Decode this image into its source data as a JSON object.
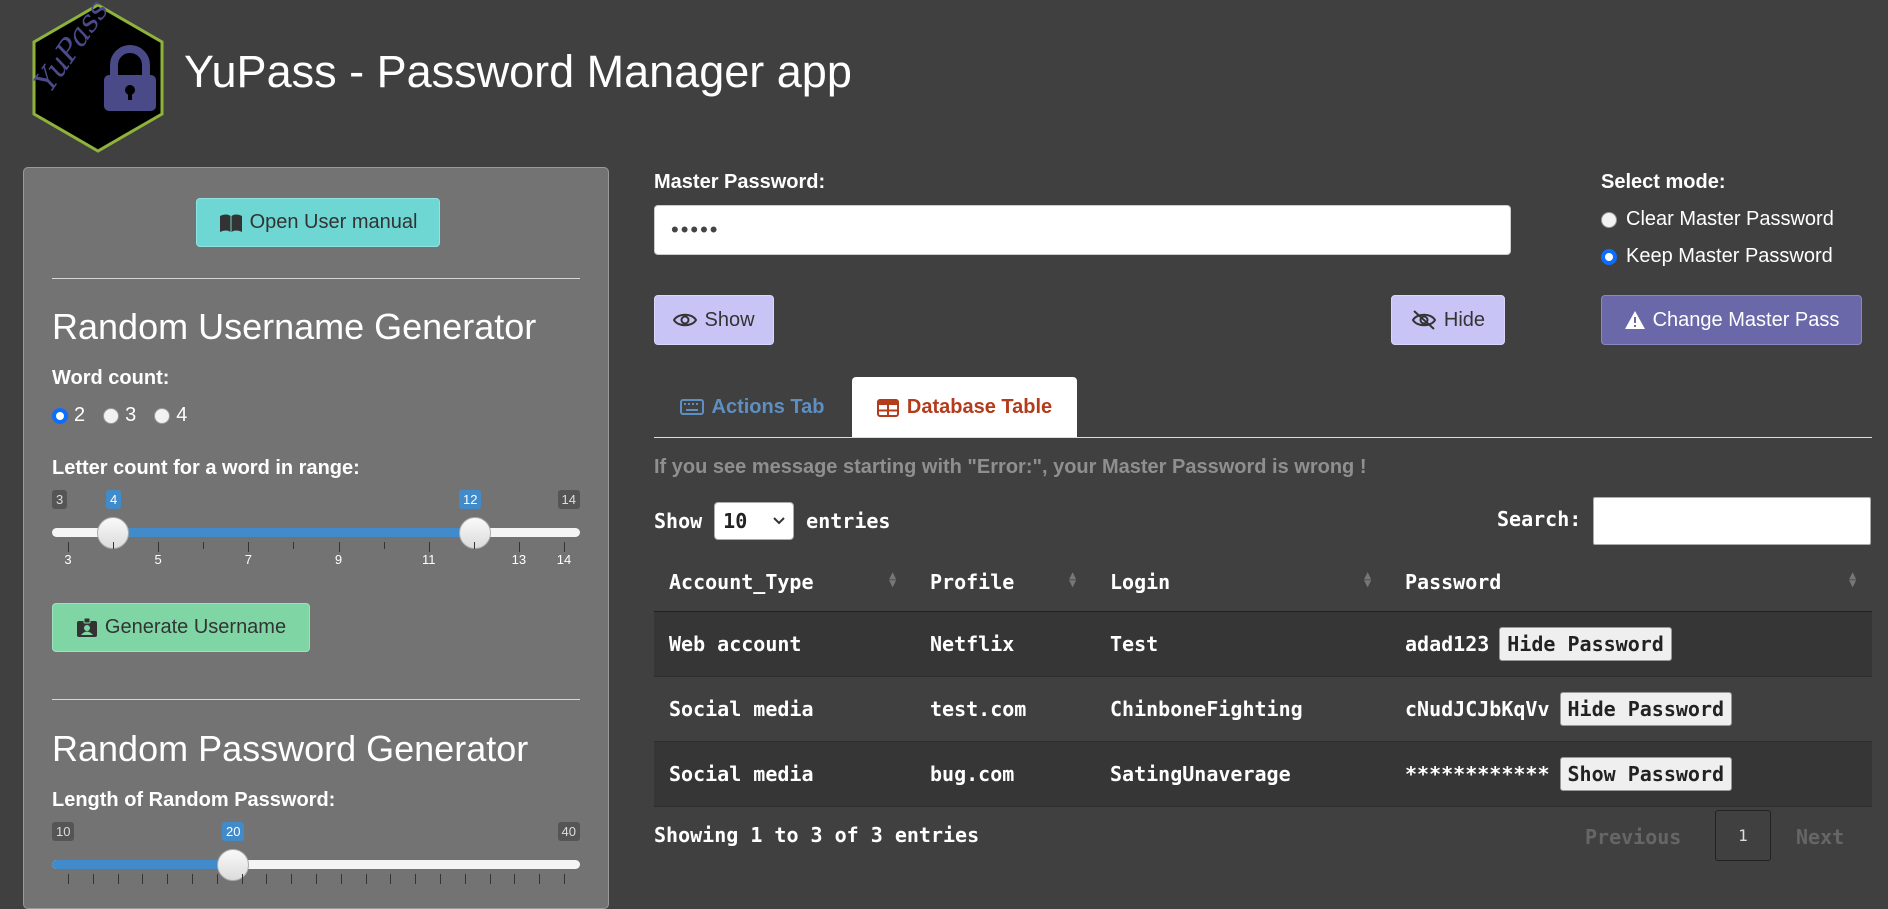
{
  "header": {
    "title": "YuPass - Password Manager app",
    "logo_text": "YuPass"
  },
  "sidebar": {
    "manual_button": "Open User manual",
    "username_section_title": "Random Username Generator",
    "word_count_label": "Word count:",
    "word_count_options": [
      "2",
      "3",
      "4"
    ],
    "word_count_selected": "2",
    "letter_range_label": "Letter count for a word in range:",
    "letter_slider": {
      "min": 3,
      "max": 14,
      "from": 4,
      "to": 12,
      "min_label": "3",
      "max_label": "14",
      "from_label": "4",
      "to_label": "12",
      "ticks": [
        "3",
        "5",
        "7",
        "9",
        "11",
        "13",
        "14"
      ]
    },
    "generate_username_button": "Generate Username",
    "password_section_title": "Random Password Generator",
    "password_length_label": "Length of Random Password:",
    "password_slider": {
      "min": 10,
      "max": 40,
      "value": 20,
      "min_label": "10",
      "max_label": "40",
      "value_label": "20"
    }
  },
  "main": {
    "master_label": "Master Password:",
    "master_value": "•••••",
    "show_button": "Show",
    "hide_button": "Hide",
    "mode_label": "Select mode:",
    "mode_options": [
      "Clear Master Password",
      "Keep Master Password"
    ],
    "mode_selected": "Keep Master Password",
    "change_button": "Change Master Pass",
    "tabs": [
      {
        "label": "Actions Tab",
        "active": false
      },
      {
        "label": "Database Table",
        "active": true
      }
    ],
    "warning": "If you see message starting with \"Error:\", your Master Password is wrong !",
    "length_show": "Show",
    "length_value": "10",
    "length_entries": "entries",
    "search_label": "Search:",
    "search_value": ""
  },
  "table": {
    "columns": [
      "Account_Type",
      "Profile",
      "Login",
      "Password"
    ],
    "rows": [
      {
        "account_type": "Web account",
        "profile": "Netflix",
        "login": "Test",
        "password": "adad123",
        "button": "Hide Password"
      },
      {
        "account_type": "Social media",
        "profile": "test.com",
        "login": "ChinboneFighting",
        "password": "cNudJCJbKqVv",
        "button": "Hide Password"
      },
      {
        "account_type": "Social media",
        "profile": "bug.com",
        "login": "SatingUnaverage",
        "password": "************",
        "button": "Show Password"
      }
    ],
    "info": "Showing 1 to 3 of 3 entries",
    "pagination": {
      "previous": "Previous",
      "current": "1",
      "next": "Next"
    }
  },
  "colors": {
    "background": "#404040",
    "sidebar": "#737373",
    "accent_blue": "#428bca",
    "purple_button": "#c8c4f6",
    "change_button": "#6a68a8",
    "active_tab_text": "#b23c1c"
  }
}
